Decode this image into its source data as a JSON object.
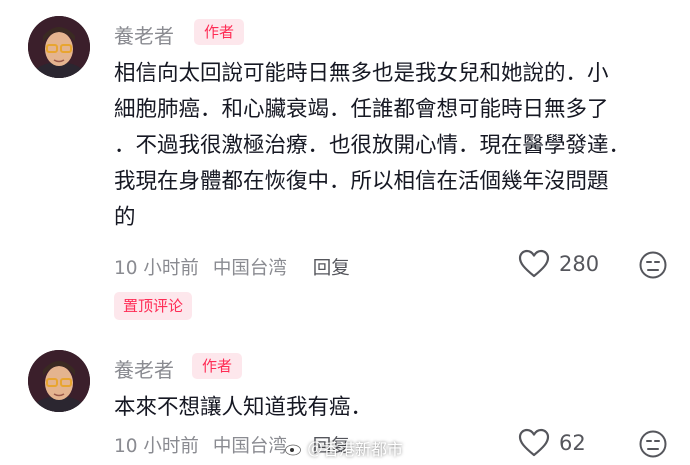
{
  "comments": [
    {
      "author": "養老者",
      "badge": "作者",
      "text_lines": [
        "相信向太回說可能時日無多也是我女兒和她說的．小",
        "細胞肺癌．和心臟衰竭．任誰都會想可能時日無多了",
        "．不過我很激極治療．也很放開心情．現在醫學發達．",
        "我現在身體都在恢復中．所以相信在活個幾年沒問題",
        "的"
      ],
      "time": "10 小时前",
      "location": "中国台湾",
      "reply_label": "回复",
      "like_count": "280",
      "pinned_label": "置顶评论"
    },
    {
      "author": "養老者",
      "badge": "作者",
      "text_lines": [
        "本來不想讓人知道我有癌．"
      ],
      "time": "10 小时前",
      "location": "中国台湾",
      "reply_label": "回复",
      "like_count": "62"
    }
  ],
  "watermark": "＠香港新都市",
  "icons": {
    "like": "heart-outline-icon",
    "dislike": "sad-face-icon",
    "watermark": "weibo-logo-icon"
  },
  "colors": {
    "accent": "#fe2c55",
    "badge_bg": "#fde7ec",
    "muted": "#8a8b91",
    "text": "#161823"
  }
}
